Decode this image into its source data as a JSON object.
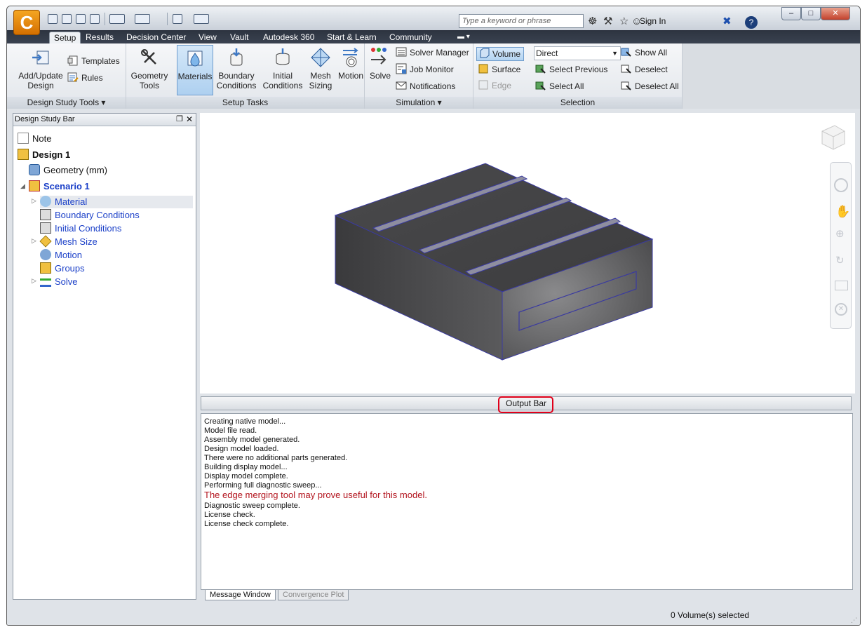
{
  "app": {
    "logo": "C"
  },
  "search": {
    "placeholder": "Type a keyword or phrase"
  },
  "title_tools": {
    "sign_in": "Sign In"
  },
  "tabs": [
    {
      "label": "Setup",
      "active": true
    },
    {
      "label": "Results"
    },
    {
      "label": "Decision Center"
    },
    {
      "label": "View"
    },
    {
      "label": "Vault"
    },
    {
      "label": "Autodesk 360"
    },
    {
      "label": "Start & Learn"
    },
    {
      "label": "Community"
    }
  ],
  "ribbon": {
    "design_study_tools": {
      "label": "Design Study Tools",
      "add_update": "Add/Update Design",
      "templates": "Templates",
      "rules": "Rules"
    },
    "setup_tasks": {
      "label": "Setup Tasks",
      "geometry_tools": "Geometry Tools",
      "materials": "Materials",
      "boundary_conditions": "Boundary Conditions",
      "initial_conditions": "Initial Conditions",
      "mesh_sizing": "Mesh Sizing",
      "motion": "Motion"
    },
    "simulation": {
      "label": "Simulation",
      "solve": "Solve",
      "solver_manager": "Solver Manager",
      "job_monitor": "Job Monitor",
      "notifications": "Notifications"
    },
    "selection": {
      "label": "Selection",
      "volume": "Volume",
      "surface": "Surface",
      "edge": "Edge",
      "mode": "Direct",
      "select_previous": "Select Previous",
      "select_all": "Select All",
      "show_all": "Show All",
      "deselect": "Deselect",
      "deselect_all": "Deselect All"
    }
  },
  "design_study_bar": {
    "title": "Design Study Bar",
    "items": [
      {
        "label": "Note"
      },
      {
        "label": "Design 1"
      },
      {
        "label": "Geometry (mm)"
      },
      {
        "label": "Scenario 1"
      },
      {
        "label": "Material"
      },
      {
        "label": "Boundary Conditions"
      },
      {
        "label": "Initial Conditions"
      },
      {
        "label": "Mesh Size"
      },
      {
        "label": "Motion"
      },
      {
        "label": "Groups"
      },
      {
        "label": "Solve"
      }
    ]
  },
  "output_bar": {
    "label": "Output Bar"
  },
  "messages": [
    "Creating native model...",
    "Model file read.",
    "Assembly model generated.",
    "Design model loaded.",
    "There were no additional parts generated.",
    "Building display model...",
    "Display model complete.",
    "Performing full diagnostic sweep...",
    "The edge merging tool may prove useful for this model.",
    "Diagnostic sweep complete.",
    "License check.",
    "License check complete."
  ],
  "message_tabs": [
    "Message Window",
    "Convergence Plot"
  ],
  "status": {
    "text": "0 Volume(s) selected"
  },
  "colors": {
    "accent": "#3e78c4",
    "warning": "#b3141e",
    "highlight_box": "#e0001a"
  }
}
